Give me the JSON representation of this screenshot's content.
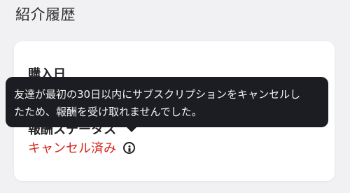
{
  "section": {
    "title": "紹介履歴"
  },
  "card": {
    "purchase_date_label": "購入日",
    "reward_status_label": "報酬ステータス",
    "status_value": "キャンセル済み",
    "status_color": "#d6261c",
    "info_icon": "info-circle-icon"
  },
  "tooltip": {
    "line1": "友達が最初の30日以内にサブスクリプションをキャンセルし",
    "line2": "たため、報酬を受け取れませんでした。"
  }
}
